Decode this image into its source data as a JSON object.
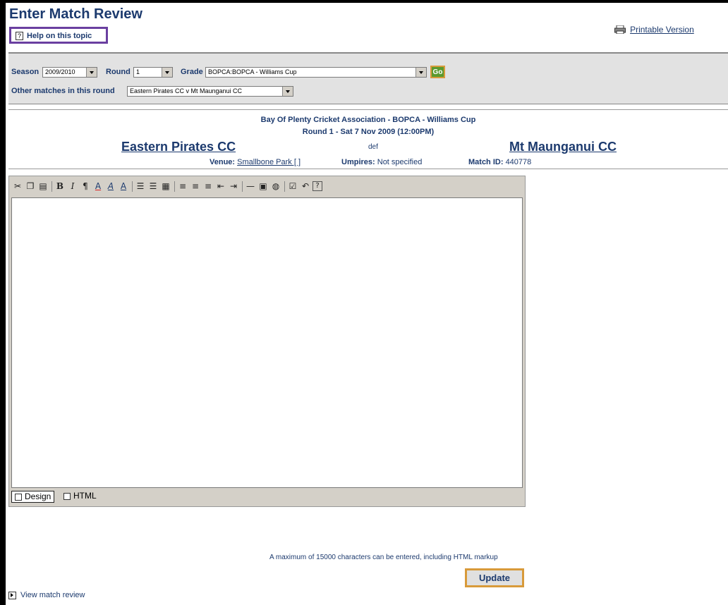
{
  "page": {
    "title": "Enter Match Review",
    "help_link": "Help on this topic",
    "printable_link": "Printable Version"
  },
  "filters": {
    "season_label": "Season",
    "season_value": "2009/2010",
    "round_label": "Round",
    "round_value": "1",
    "grade_label": "Grade",
    "grade_value": "BOPCA:BOPCA - Williams Cup",
    "go_label": "Go",
    "other_label": "Other matches in this round",
    "other_value": "Eastern Pirates CC v Mt Maunganui CC"
  },
  "match": {
    "association": "Bay Of Plenty Cricket Association - BOPCA - Williams Cup",
    "round_line": "Round 1 - Sat 7 Nov 2009 (12:00PM)",
    "home_team": "Eastern Pirates CC",
    "result_word": "def",
    "away_team": "Mt Maunganui CC",
    "venue_label": "Venue:",
    "venue_value": "Smallbone Park [ ]",
    "umpires_label": "Umpires:",
    "umpires_value": "Not specified",
    "matchid_label": "Match ID:",
    "matchid_value": "440778"
  },
  "editor": {
    "toolbar_icons": [
      "cut-icon",
      "copy-icon",
      "paste-icon",
      "bold-icon",
      "italic-icon",
      "paragraph-icon",
      "font-color-icon",
      "highlight-icon",
      "superscript-icon",
      "ordered-list-icon",
      "unordered-list-icon",
      "table-icon",
      "align-left-icon",
      "align-center-icon",
      "align-right-icon",
      "outdent-icon",
      "indent-icon",
      "horizontal-rule-icon",
      "image-icon",
      "link-icon",
      "spellcheck-icon",
      "undo-icon",
      "help-icon"
    ],
    "design_tab": "Design",
    "html_tab": "HTML"
  },
  "footer": {
    "max_note": "A maximum of 15000 characters can be entered, including HTML markup",
    "update_label": "Update",
    "view_link": "View match review"
  },
  "colors": {
    "accent": "#1c3a6e",
    "help_border": "#6a3fa0",
    "highlight_border": "#d89a3a",
    "go_green": "#5a9a2e"
  }
}
